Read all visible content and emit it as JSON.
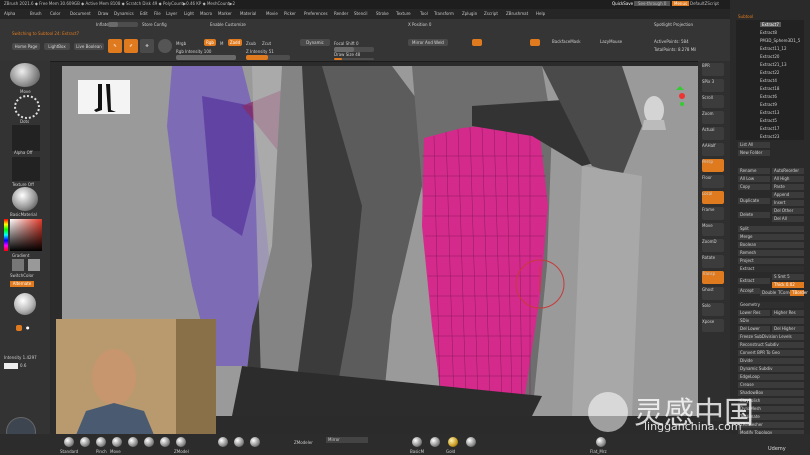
{
  "app": {
    "title": "ZBrush 2021.6",
    "title_bar_text": "ZBrush 2021.6  ◆ Free Mem 30.609GB ◆ Active Mem 8108 ◆ Scratch Disk 49 ◆ PolyCount▶0.46 KP ◆ MeshCount▶2",
    "quicksave_label": "QuickSave",
    "see_through_label": "See-through 0",
    "menus_label": "Menus",
    "default_script_label": "DefaultZScript"
  },
  "menu": [
    "Alpha",
    "Brush",
    "Color",
    "Document",
    "Draw",
    "Dynamics",
    "Edit",
    "File",
    "Layer",
    "Light",
    "Macro",
    "Marker",
    "Material",
    "Movie",
    "Picker",
    "Preferences",
    "Render",
    "Stencil",
    "Stroke",
    "Texture",
    "Tool",
    "Transform",
    "Zplugin",
    "Zscript",
    "ZBrushmat",
    "Help"
  ],
  "toolbar": {
    "note_label": "Switching to Subtool 24: Extract7",
    "home_page": "Home Page",
    "lightbox": "LightBox",
    "live_boolean": "Live Boolean",
    "edit": "Edit",
    "draw": "Draw",
    "move": "Move",
    "mrgb": "Mrgb",
    "rgb": "Rgb",
    "m": "M",
    "zadd": "Zadd",
    "zsub": "Zsub",
    "zcut": "Zcut",
    "rgb_intensity_label": "Rgb Intensity 100",
    "z_intensity_label": "Z Intensity 51",
    "focal_shift_label": "Focal Shift 0",
    "draw_size_label": "Draw Size 48",
    "dynamic": "Dynamic",
    "mirror_weld": "Mirror And Weld",
    "backface": "BackfaceMask",
    "lazymouse": "LazyMouse",
    "active_points": "ActivePoints: 584",
    "total_points": "TotalPoints: 8.278 Mil",
    "spotlight": "Spotlight Projection",
    "inflate": "Inflate",
    "store_config": "Store Config",
    "enable_customize": "Enable Customize",
    "x_position": "X Position 0"
  },
  "left_shelf": {
    "brush_label": "Move",
    "stroke_label": "Dots",
    "alpha_label": "Alpha Off",
    "texture_label": "Texture Off",
    "material_label": "BasicMaterial",
    "gradient_label": "Gradient",
    "switch_color": "SwitchColor",
    "alternate": "Alternate",
    "intensity_label": "Intensity 1.4297",
    "light_label": "0.6",
    "color_main": "#e33b2b"
  },
  "tray": {
    "header": "Subtool",
    "items": [
      "Extract7",
      "Extract8",
      "PM3D_Sphere3D1_5",
      "Extract11_12",
      "Extract20",
      "Extract21_13",
      "Extract22",
      "Extract4",
      "Extract18",
      "Extract6",
      "Extract9",
      "Extract13",
      "Extract5",
      "Extract17",
      "Extract23"
    ],
    "list_all": "List All",
    "new_folder": "New Folder",
    "rename": "Rename",
    "auto_reorder": "AutoReorder",
    "all_low": "All Low",
    "all_high": "All High",
    "copy": "Copy",
    "paste": "Paste",
    "append": "Append",
    "duplicate": "Duplicate",
    "insert": "Insert",
    "delete": "Delete",
    "del_other": "Del Other",
    "del_all": "Del All",
    "split": "Split",
    "merge": "Merge",
    "boolean": "Boolean",
    "remesh": "Remesh",
    "project": "Project",
    "extract_header": "Extract",
    "smt": "S Smt 5",
    "thick": "Thick 0.02",
    "extract_btn": "Extract",
    "accept": "Accept",
    "double": "Double",
    "tcorner": "TCorner",
    "tborder": "TBorder",
    "geometry_header": "Geometry",
    "lower_res": "Lower Res",
    "higher_res": "Higher Res",
    "sdiv": "SDiv",
    "del_lower": "Del Lower",
    "del_higher": "Del Higher",
    "freeze": "Freeze SubDivision Levels",
    "reconstruct": "Reconstruct Subdiv",
    "convert_bpr": "Convert BPR To Geo",
    "divide": "Divide",
    "dynamic_subdiv": "Dynamic Subdiv",
    "edge_loop": "EdgeLoop",
    "crease": "Crease",
    "shadowbox": "ShadowBox",
    "claypolish": "ClayPolish",
    "dynamesh": "DynaMesh",
    "tessimate": "Tessimate",
    "zremesher": "ZRemesher",
    "modify_topology": "Modify Topology"
  },
  "bottom": {
    "brushes": [
      "Standard",
      "ClayTub",
      "Pinch",
      "Move",
      "hPolish",
      "Inflat",
      "DamStd",
      "ZModel",
      "TrimDyn",
      "Move T",
      "Alpha"
    ],
    "zmodeler": "ZModeler",
    "mirror": "Mirror",
    "materials": [
      "BasicM",
      "Matcap",
      "Gold",
      "ToyPlas"
    ],
    "flat": "Flat_Mrz",
    "watermark_cn": "灵感中国",
    "watermark_url": "lingganchina.com",
    "udemy": "Udemy"
  },
  "right_shelf": {
    "buttons": [
      "BPR",
      "SPix 3",
      "Scroll",
      "Zoom",
      "Actual",
      "AAHalf",
      "Persp",
      "Floor",
      "Local",
      "Frame",
      "Move",
      "ZoomD",
      "Rotate",
      "Transp",
      "Ghost",
      "Solo",
      "Xpose"
    ]
  },
  "colors": {
    "accent": "#e07a1e",
    "mesh_pink": "#d42a8c",
    "viewport_bg": "#9a9a9a"
  }
}
